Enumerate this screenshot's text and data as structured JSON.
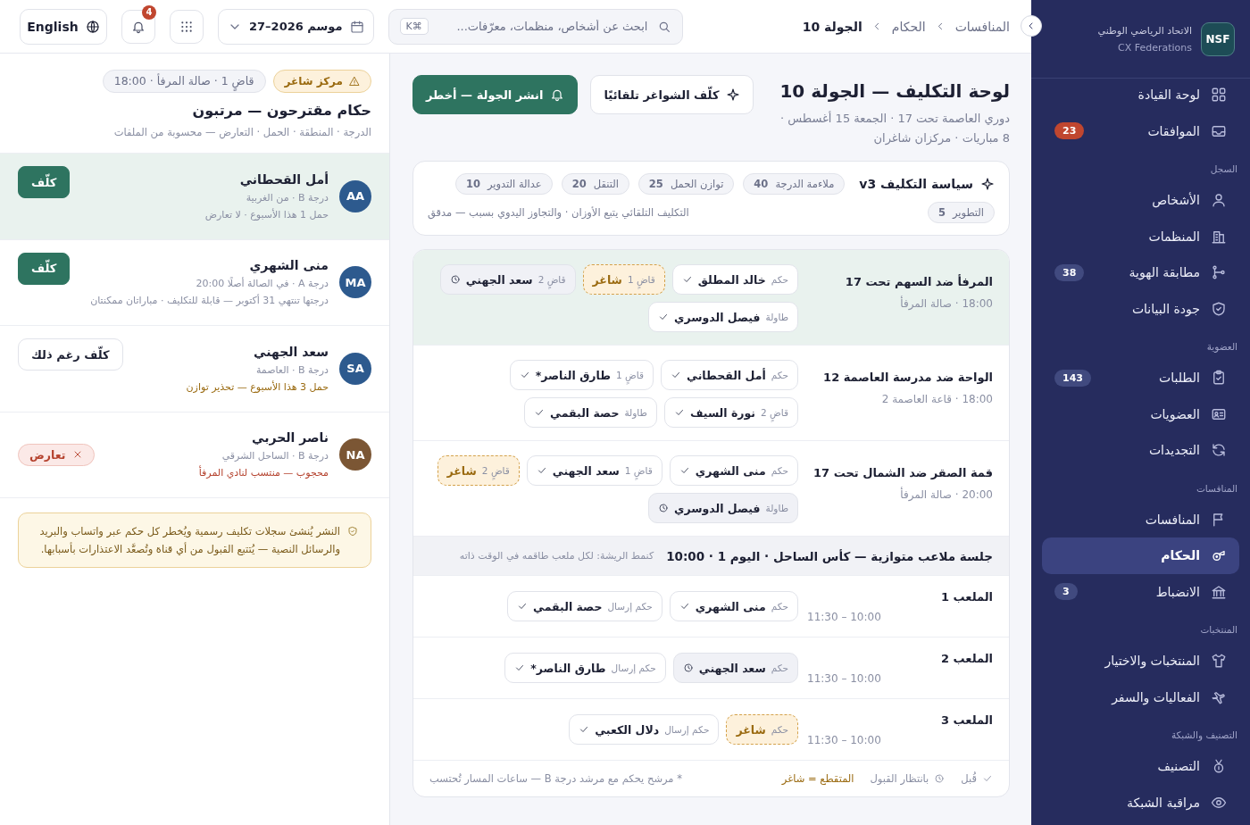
{
  "sidebar": {
    "logo": "NSF",
    "org_name": "الاتحاد الرياضي الوطني",
    "org_subtitle": "CX Federations",
    "sections": [
      {
        "items": [
          {
            "label": "لوحة القيادة",
            "selected": false
          },
          {
            "label": "الموافقات",
            "selected": false,
            "badge": {
              "text": "23",
              "alert": true
            }
          }
        ]
      },
      {
        "heading": "السجل",
        "items": [
          {
            "label": "الأشخاص",
            "selected": false
          },
          {
            "label": "المنظمات",
            "selected": false
          },
          {
            "label": "مطابقة الهوية",
            "selected": false,
            "badge": {
              "text": "38",
              "alert": false
            }
          },
          {
            "label": "جودة البيانات",
            "selected": false
          }
        ]
      },
      {
        "heading": "العضوية",
        "items": [
          {
            "label": "الطلبات",
            "selected": false,
            "badge": {
              "text": "143",
              "alert": false
            }
          },
          {
            "label": "العضويات",
            "selected": false
          },
          {
            "label": "التجديدات",
            "selected": false
          }
        ]
      },
      {
        "heading": "المنافسات",
        "items": [
          {
            "label": "المنافسات",
            "selected": false
          },
          {
            "label": "الحكام",
            "selected": true
          },
          {
            "label": "الانضباط",
            "selected": false,
            "badge": {
              "text": "3",
              "alert": false
            }
          }
        ]
      },
      {
        "heading": "المنتخبات",
        "items": [
          {
            "label": "المنتخبات والاختيار",
            "selected": false
          },
          {
            "label": "الفعاليات والسفر",
            "selected": false
          }
        ]
      },
      {
        "heading": "التصنيف والشبكة",
        "items": [
          {
            "label": "التصنيف",
            "selected": false
          },
          {
            "label": "مراقبة الشبكة",
            "selected": false
          }
        ]
      }
    ]
  },
  "topbar": {
    "breadcrumbs": [
      {
        "label": "المنافسات",
        "current": false
      },
      {
        "label": "الحكام",
        "current": false
      },
      {
        "label": "الجولة 10",
        "current": true
      }
    ],
    "search": {
      "placeholder": "ابحث عن أشخاص، منظمات، معرّفات...",
      "shortcut": "⌘K"
    },
    "season": "موسم 2026–27",
    "notifications": "4",
    "language": "English"
  },
  "header": {
    "title": "لوحة التكليف — الجولة 10",
    "subtitle": "دوري العاصمة تحت 17 · الجمعة 15 أغسطس · 8 مباريات · مركزان شاغران",
    "auto_button": "كلّف الشواغر تلقائيًا",
    "publish_button": "انشر الجولة — أخطر"
  },
  "policy": {
    "title": "سياسة التكليف v3",
    "weights": [
      {
        "label": "ملاءمة الدرجة",
        "value": "40"
      },
      {
        "label": "توازن الحمل",
        "value": "25"
      },
      {
        "label": "التنقل",
        "value": "20"
      },
      {
        "label": "عدالة التدوير",
        "value": "10"
      },
      {
        "label": "التطوير",
        "value": "5"
      }
    ],
    "note": "التكليف التلقائي يتبع الأوزان · والتجاوز اليدوي بسبب — مدقق"
  },
  "matches": [
    {
      "title": "المرفأ ضد السهم تحت 17",
      "meta": "18:00 · صالة المرفأ",
      "selected": true,
      "slots": [
        {
          "role": "حكم",
          "name": "خالد المطلق",
          "kind": "accepted"
        },
        {
          "role": "قاضٍ 1",
          "name": "شاغر",
          "kind": "vacant"
        },
        {
          "role": "قاضٍ 2",
          "name": "سعد الجهني",
          "kind": "pending"
        },
        {
          "role": "طاولة",
          "name": "فيصل الدوسري",
          "kind": "accepted"
        }
      ]
    },
    {
      "title": "الواحة ضد مدرسة العاصمة 12",
      "meta": "18:00 · قاعة العاصمة 2",
      "selected": false,
      "slots": [
        {
          "role": "حكم",
          "name": "أمل القحطاني",
          "kind": "accepted"
        },
        {
          "role": "قاضٍ 1",
          "name": "طارق الناصر*",
          "kind": "accepted"
        },
        {
          "role": "قاضٍ 2",
          "name": "نورة السيف",
          "kind": "accepted"
        },
        {
          "role": "طاولة",
          "name": "حصة البقمي",
          "kind": "accepted"
        }
      ]
    },
    {
      "title": "قمة الصقر ضد الشمال تحت 17",
      "meta": "20:00 · صالة المرفأ",
      "selected": false,
      "slots": [
        {
          "role": "حكم",
          "name": "منى الشهري",
          "kind": "accepted"
        },
        {
          "role": "قاضٍ 1",
          "name": "سعد الجهني",
          "kind": "accepted"
        },
        {
          "role": "قاضٍ 2",
          "name": "شاغر",
          "kind": "vacant"
        },
        {
          "role": "طاولة",
          "name": "فيصل الدوسري",
          "kind": "pending"
        }
      ]
    }
  ],
  "session": {
    "title": "جلسة ملاعب متوازية — كأس الساحل · اليوم 1 · 10:00",
    "note": "كنمط الريشة: لكل ملعب طاقمه في الوقت ذاته",
    "courts": [
      {
        "title": "الملعب 1",
        "time": "10:00 – 11:30",
        "slots": [
          {
            "role": "حكم",
            "name": "منى الشهري",
            "kind": "accepted"
          },
          {
            "role": "حكم إرسال",
            "name": "حصة البقمي",
            "kind": "accepted"
          }
        ]
      },
      {
        "title": "الملعب 2",
        "time": "10:00 – 11:30",
        "slots": [
          {
            "role": "حكم",
            "name": "سعد الجهني",
            "kind": "pending"
          },
          {
            "role": "حكم إرسال",
            "name": "طارق الناصر*",
            "kind": "accepted"
          }
        ]
      },
      {
        "title": "الملعب 3",
        "time": "10:00 – 11:30",
        "slots": [
          {
            "role": "حكم",
            "name": "شاغر",
            "kind": "vacant"
          },
          {
            "role": "حكم إرسال",
            "name": "دلال الكعبي",
            "kind": "accepted"
          }
        ]
      }
    ]
  },
  "legend": [
    {
      "kind": "accepted",
      "label": "قُبل"
    },
    {
      "kind": "pending",
      "label": "بانتظار القبول"
    },
    {
      "kind": "vacant",
      "label": "المتقطع = شاغر"
    },
    {
      "kind": "note",
      "label": "* مرشح يحكم مع مرشد درجة B — ساعات المسار تُحتسب"
    }
  ],
  "panel": {
    "vacancy_badge": "مركز شاغر",
    "slot_info": "قاضٍ 1 · صالة المرفأ · 18:00",
    "title": "حكام مقترحون — مرتبون",
    "subtitle": "الدرجة · المنطقة · الحمل · التعارض — محسوبة من الملفات",
    "candidates": [
      {
        "initials": "AA",
        "color": "#2d5a8e",
        "name": "أمل القحطاني",
        "line1": "درجة B · من الغربية",
        "line2": {
          "text": "حمل 1 هذا الأسبوع · لا تعارض",
          "kind": "normal"
        },
        "selected": true,
        "action": {
          "kind": "primary",
          "label": "كلّف"
        }
      },
      {
        "initials": "MA",
        "color": "#2d5a8e",
        "name": "منى الشهري",
        "line1": "درجة A · في الصالة أصلًا 20:00",
        "line2": {
          "text": "درجتها تنتهي 31 أكتوبر — قابلة للتكليف · مباراتان ممكنتان",
          "kind": "normal"
        },
        "selected": false,
        "action": {
          "kind": "primary",
          "label": "كلّف"
        }
      },
      {
        "initials": "SA",
        "color": "#2d5a8e",
        "name": "سعد الجهني",
        "line1": "درجة B · العاصمة",
        "line2": {
          "text": "حمل 3 هذا الأسبوع — تحذير توازن",
          "kind": "warning"
        },
        "selected": false,
        "action": {
          "kind": "outline",
          "label": "كلّف رغم ذلك"
        }
      },
      {
        "initials": "NA",
        "color": "#7b5634",
        "name": "ناصر الحربي",
        "line1": "درجة B · الساحل الشرقي",
        "line2": {
          "text": "محجوب — منتسب لنادي المرفأ",
          "kind": "danger"
        },
        "selected": false,
        "action": {
          "kind": "conflict",
          "label": "تعارض"
        }
      }
    ],
    "notice": "النشر يُنشئ سجلات تكليف رسمية ويُخطر كل حكم عبر واتساب والبريد والرسائل النصية — يُتتبع القبول من أي قناة وتُصعَّد الاعتذارات بأسبابها."
  }
}
